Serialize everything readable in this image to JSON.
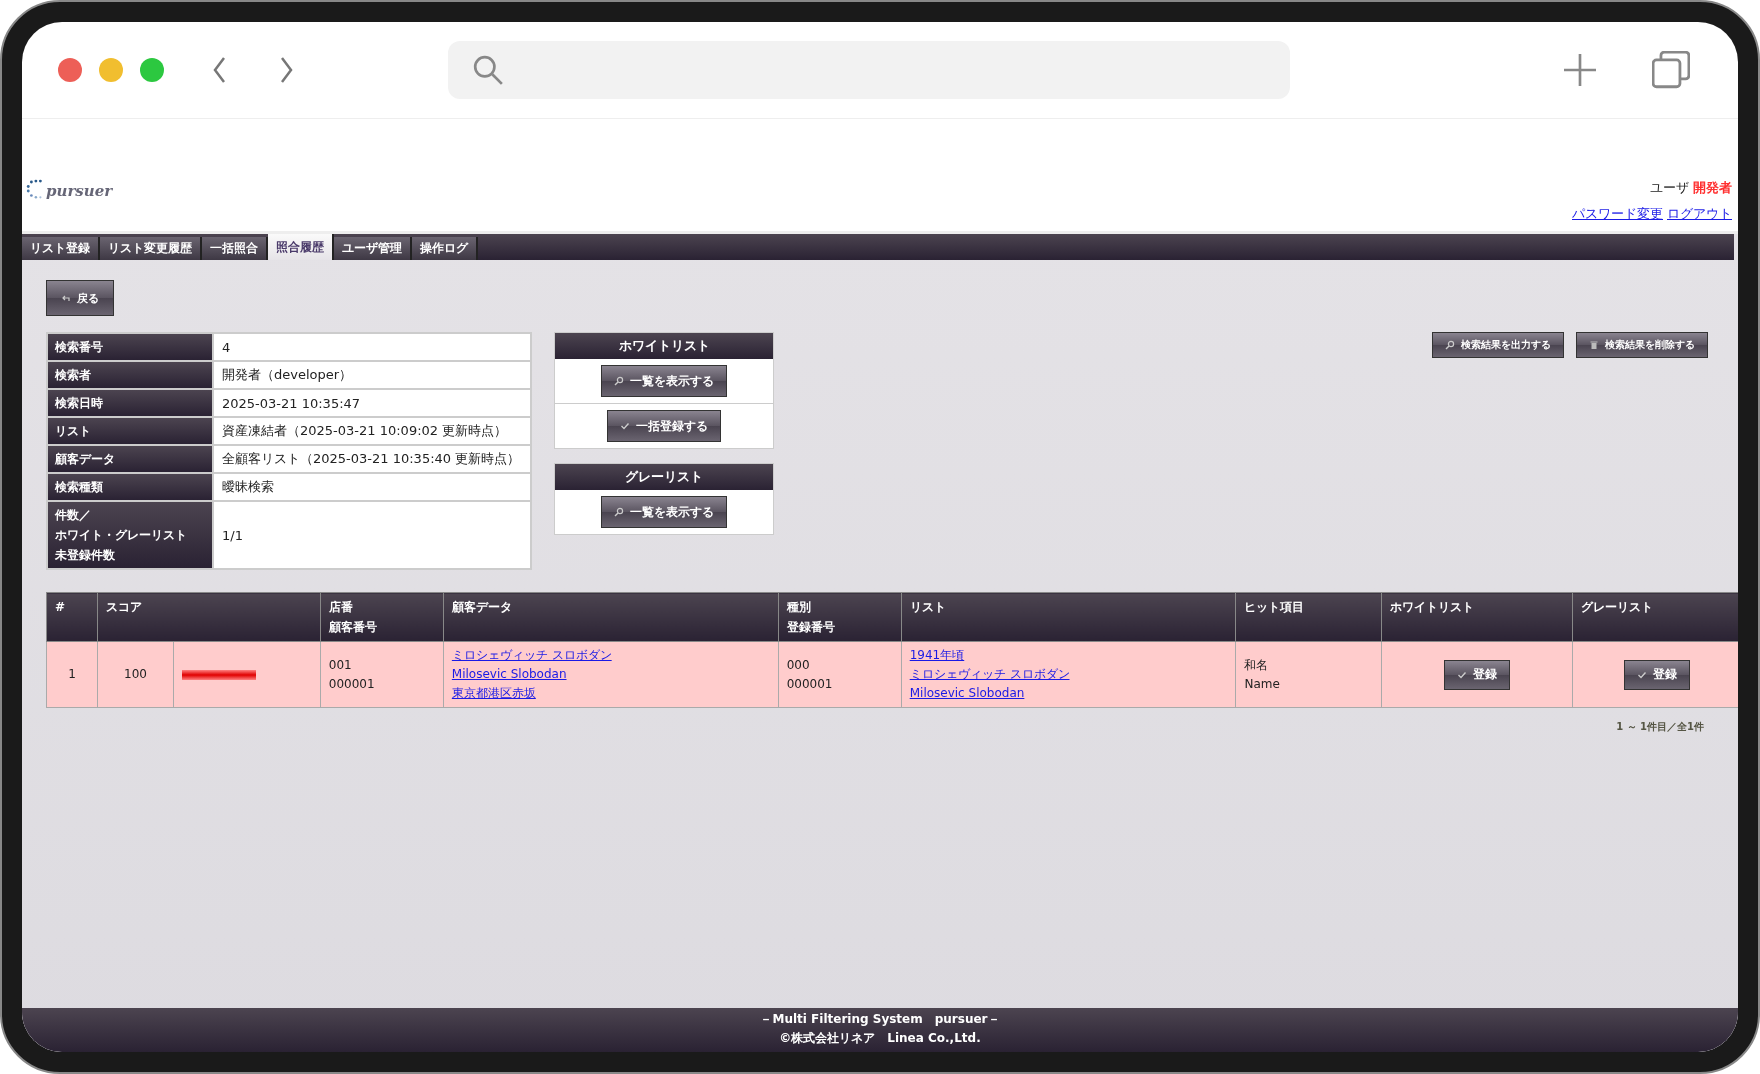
{
  "header": {
    "logo": "pursuer",
    "user_label": "ユーザ",
    "user_name": "開発者",
    "links": [
      "パスワード変更",
      "ログアウト"
    ]
  },
  "tabs": [
    {
      "label": "リスト登録",
      "selected": false
    },
    {
      "label": "リスト変更履歴",
      "selected": false
    },
    {
      "label": "一括照合",
      "selected": false
    },
    {
      "label": "照合履歴",
      "selected": true
    },
    {
      "label": "ユーザ管理",
      "selected": false
    },
    {
      "label": "操作ログ",
      "selected": false
    }
  ],
  "back_button": "戻る",
  "info": [
    {
      "label": [
        "検索番号"
      ],
      "value": "4"
    },
    {
      "label": [
        "検索者"
      ],
      "value": "開発者（developer）"
    },
    {
      "label": [
        "検索日時"
      ],
      "value": "2025-03-21 10:35:47"
    },
    {
      "label": [
        "リスト"
      ],
      "value": "資産凍結者（2025-03-21 10:09:02 更新時点）"
    },
    {
      "label": [
        "顧客データ"
      ],
      "value": "全顧客リスト（2025-03-21 10:35:40 更新時点）"
    },
    {
      "label": [
        "検索種類"
      ],
      "value": "曖昧検索"
    },
    {
      "label": [
        "件数／",
        "ホワイト・グレーリスト",
        "未登録件数"
      ],
      "value": "1/1"
    }
  ],
  "panels": [
    {
      "title": "ホワイトリスト",
      "buttons": [
        {
          "label": "一覧を表示する",
          "kind": "search"
        },
        {
          "label": "一括登録する",
          "kind": "check"
        }
      ]
    },
    {
      "title": "グレーリスト",
      "buttons": [
        {
          "label": "一覧を表示する",
          "kind": "search"
        }
      ]
    }
  ],
  "actions": [
    {
      "label": "検索結果を出力する",
      "kind": "search"
    },
    {
      "label": "検索結果を削除する",
      "kind": "trash"
    }
  ],
  "results": {
    "columns": [
      [
        "#"
      ],
      [
        "スコア"
      ],
      [
        "店番",
        "顧客番号"
      ],
      [
        "顧客データ"
      ],
      [
        "種別",
        "登録番号"
      ],
      [
        "リスト"
      ],
      [
        "ヒット項目"
      ],
      [
        "ホワイトリスト"
      ],
      [
        "グレーリスト"
      ]
    ],
    "rows": [
      {
        "number": "1",
        "score": "100",
        "level": 1,
        "store": [
          "001",
          "000001"
        ],
        "customer": [
          "ミロシェヴィッチ スロボダン",
          "Milosevic Slobodan",
          "東京都港区赤坂"
        ],
        "type": [
          "000",
          "000001"
        ],
        "list": [
          "1941年頃",
          "ミロシェヴィッチ スロボダン",
          "Milosevic Slobodan"
        ],
        "hits": [
          "和名",
          "Name"
        ],
        "white_button": "登録",
        "grey_button": "登録"
      }
    ]
  },
  "pager": "1 ～ 1件目／全1件",
  "footer": [
    "－Multi Filtering System　pursuer－",
    "©株式会社リネア　Linea Co.,Ltd."
  ]
}
